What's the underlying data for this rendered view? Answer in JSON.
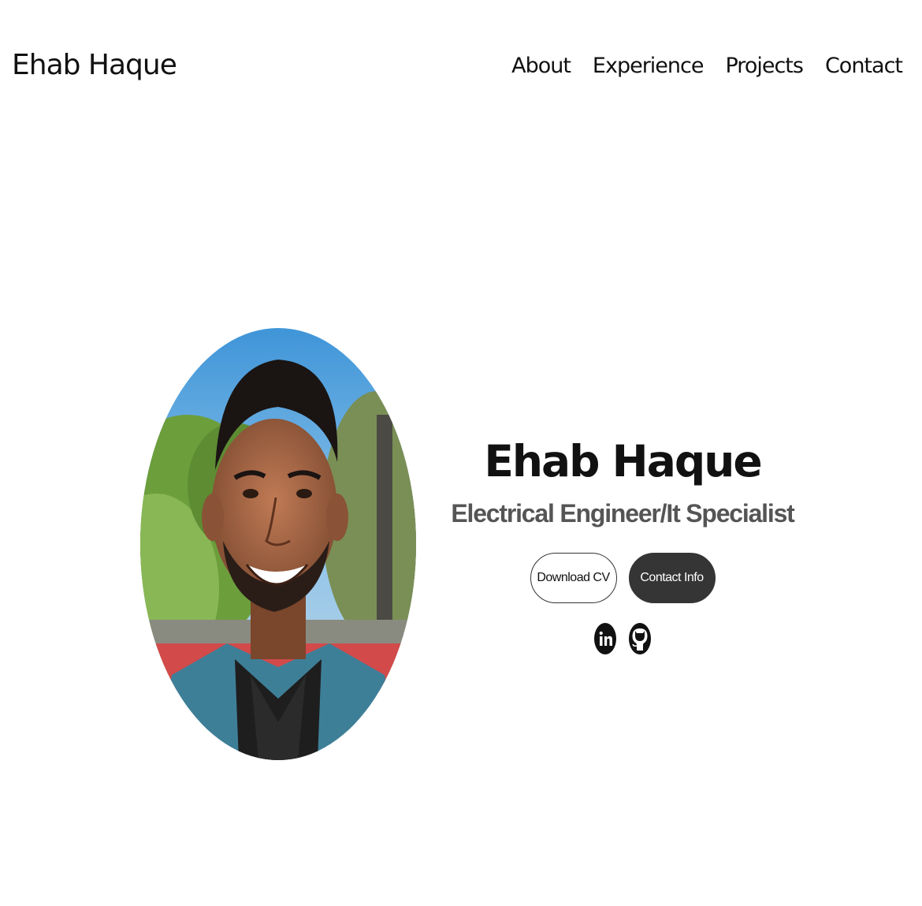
{
  "nav": {
    "logo": "Ehab Haque",
    "links": [
      "About",
      "Experience",
      "Projects",
      "Contact"
    ]
  },
  "hero": {
    "name": "Ehab Haque",
    "title": "Electrical Engineer/It Specialist",
    "buttons": {
      "download": "Download CV",
      "contact": "Contact Info"
    },
    "social": [
      "linkedin-icon",
      "github-icon"
    ]
  },
  "colors": {
    "text": "#111111",
    "subtitle": "#555555",
    "button_dark": "#353535",
    "background": "#ffffff"
  }
}
